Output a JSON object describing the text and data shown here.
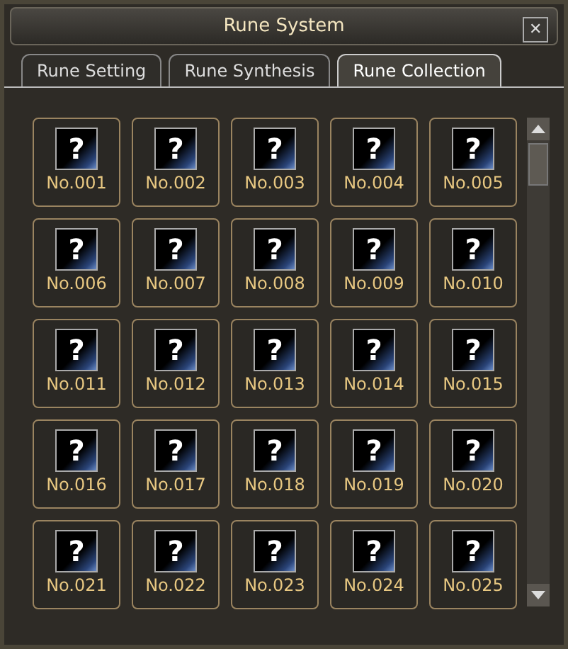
{
  "window": {
    "title": "Rune System",
    "close": "✕"
  },
  "tabs": [
    {
      "label": "Rune Setting",
      "selected": false
    },
    {
      "label": "Rune Synthesis",
      "selected": false
    },
    {
      "label": "Rune Collection",
      "selected": true
    }
  ],
  "runes": [
    {
      "symbol": "?",
      "label": "No.001"
    },
    {
      "symbol": "?",
      "label": "No.002"
    },
    {
      "symbol": "?",
      "label": "No.003"
    },
    {
      "symbol": "?",
      "label": "No.004"
    },
    {
      "symbol": "?",
      "label": "No.005"
    },
    {
      "symbol": "?",
      "label": "No.006"
    },
    {
      "symbol": "?",
      "label": "No.007"
    },
    {
      "symbol": "?",
      "label": "No.008"
    },
    {
      "symbol": "?",
      "label": "No.009"
    },
    {
      "symbol": "?",
      "label": "No.010"
    },
    {
      "symbol": "?",
      "label": "No.011"
    },
    {
      "symbol": "?",
      "label": "No.012"
    },
    {
      "symbol": "?",
      "label": "No.013"
    },
    {
      "symbol": "?",
      "label": "No.014"
    },
    {
      "symbol": "?",
      "label": "No.015"
    },
    {
      "symbol": "?",
      "label": "No.016"
    },
    {
      "symbol": "?",
      "label": "No.017"
    },
    {
      "symbol": "?",
      "label": "No.018"
    },
    {
      "symbol": "?",
      "label": "No.019"
    },
    {
      "symbol": "?",
      "label": "No.020"
    },
    {
      "symbol": "?",
      "label": "No.021"
    },
    {
      "symbol": "?",
      "label": "No.022"
    },
    {
      "symbol": "?",
      "label": "No.023"
    },
    {
      "symbol": "?",
      "label": "No.024"
    },
    {
      "symbol": "?",
      "label": "No.025"
    }
  ]
}
